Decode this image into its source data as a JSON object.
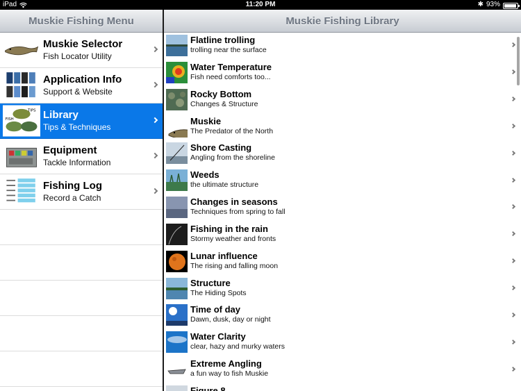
{
  "status_bar": {
    "carrier": "iPad",
    "time": "11:20 PM",
    "battery": "93%",
    "battery_level": 0.93
  },
  "left_pane": {
    "title": "Muskie Fishing Menu",
    "items": [
      {
        "title": "Muskie Selector",
        "subtitle": "Fish Locator Utility",
        "icon": "muskie-fish-icon",
        "selected": false
      },
      {
        "title": "Application Info",
        "subtitle": "Support & Website",
        "icon": "app-screenshots-icon",
        "selected": false
      },
      {
        "title": "Library",
        "subtitle": "Tips & Techniques",
        "icon": "fish-tips-icon",
        "selected": true
      },
      {
        "title": "Equipment",
        "subtitle": "Tackle Information",
        "icon": "tackle-box-icon",
        "selected": false
      },
      {
        "title": "Fishing Log",
        "subtitle": "Record a Catch",
        "icon": "fishing-log-icon",
        "selected": false
      }
    ]
  },
  "right_pane": {
    "title": "Muskie Fishing Library",
    "items": [
      {
        "title": "Flatline trolling",
        "subtitle": "trolling near the surface",
        "icon": "lake-view-icon"
      },
      {
        "title": "Water Temperature",
        "subtitle": "Fish need comforts too...",
        "icon": "temperature-map-icon"
      },
      {
        "title": "Rocky Bottom",
        "subtitle": "Changes & Structure",
        "icon": "rocky-bottom-icon"
      },
      {
        "title": "Muskie",
        "subtitle": "The Predator of the North",
        "icon": "muskie-fish-icon"
      },
      {
        "title": "Shore Casting",
        "subtitle": "Angling from the shoreline",
        "icon": "shore-casting-icon"
      },
      {
        "title": "Weeds",
        "subtitle": "the ultimate structure",
        "icon": "weeds-icon"
      },
      {
        "title": "Changes in seasons",
        "subtitle": "Techniques from spring to fall",
        "icon": "seasons-icon"
      },
      {
        "title": "Fishing in the rain",
        "subtitle": "Stormy weather and fronts",
        "icon": "rain-icon"
      },
      {
        "title": "Lunar influence",
        "subtitle": "The rising and falling moon",
        "icon": "moon-icon"
      },
      {
        "title": "Structure",
        "subtitle": "The Hiding Spots",
        "icon": "structure-icon"
      },
      {
        "title": "Time of day",
        "subtitle": "Dawn, dusk, day or night",
        "icon": "sun-icon"
      },
      {
        "title": "Water Clarity",
        "subtitle": "clear, hazy and murky waters",
        "icon": "water-clarity-icon"
      },
      {
        "title": "Extreme Angling",
        "subtitle": "a fun way to fish Muskie",
        "icon": "boat-icon"
      },
      {
        "title": "Figure 8",
        "subtitle": "",
        "icon": "figure-8-icon"
      }
    ]
  },
  "colors": {
    "selection": "#0a78e8",
    "navbar_text": "#6e7682"
  }
}
